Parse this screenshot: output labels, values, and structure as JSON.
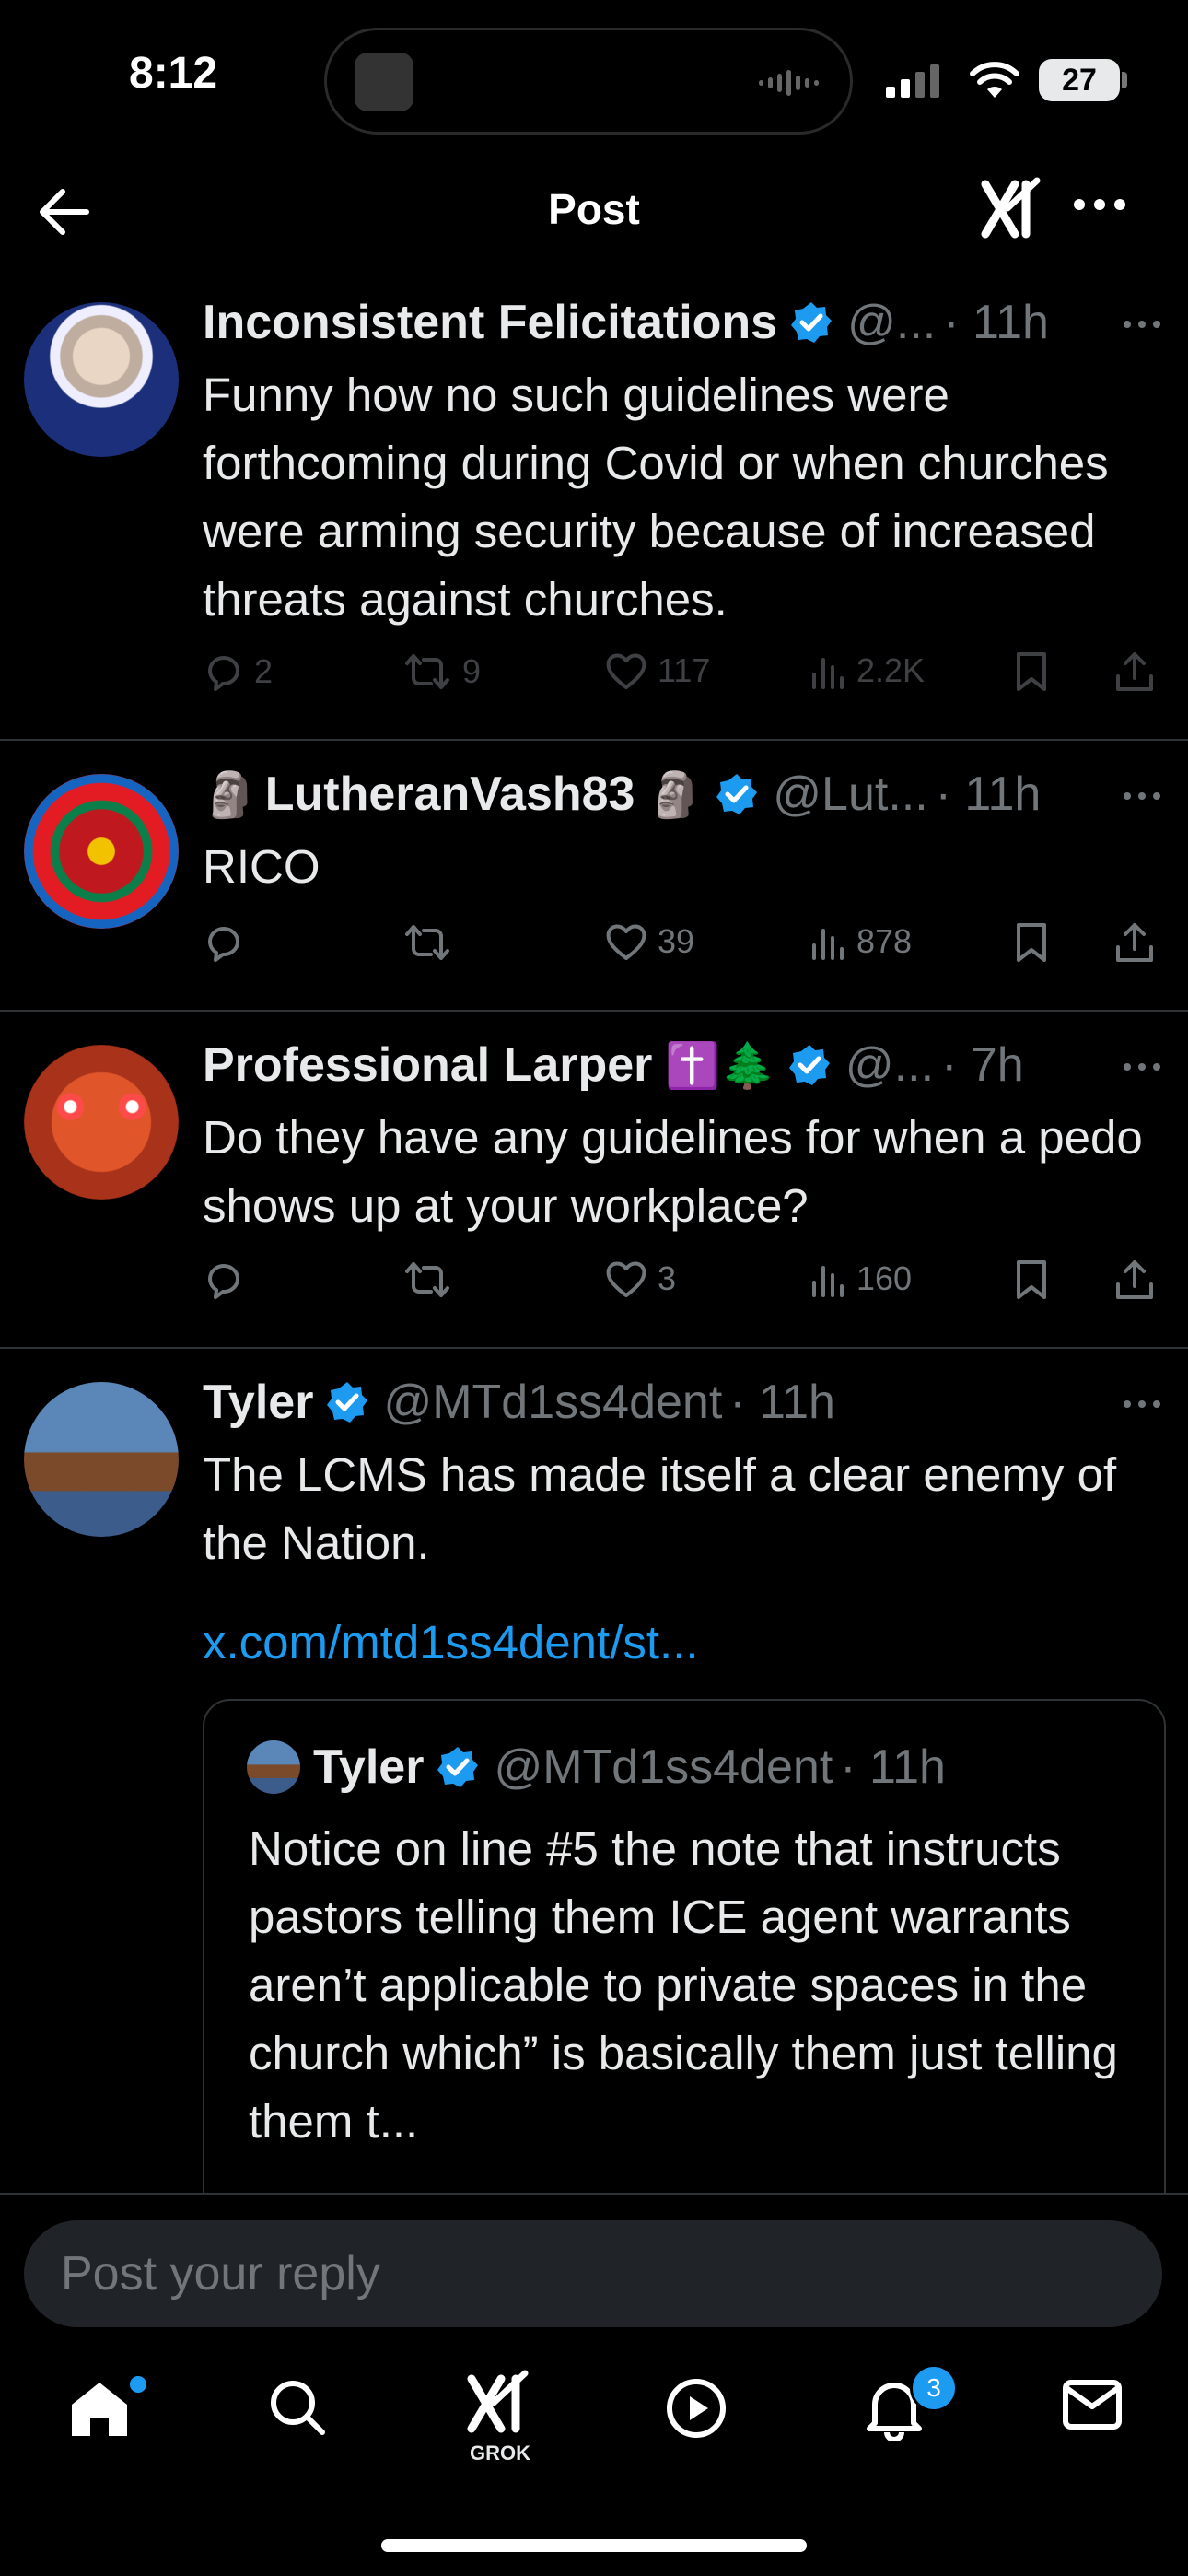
{
  "status_bar": {
    "time": "8:12",
    "battery": "27"
  },
  "header": {
    "title": "Post"
  },
  "posts": [
    {
      "name": "Inconsistent Felicitations",
      "handle": "@...",
      "time": "· 11h",
      "text": "Funny how no such guidelines were forthcoming during Covid or when churches were arming security because of increased threats against churches.",
      "replies": "2",
      "reposts": "9",
      "likes": "117",
      "views": "2.2K"
    },
    {
      "name_prefix_emoji": "🗿",
      "name": "LutheranVash83",
      "name_suffix_emoji": "🗿",
      "handle": "@Lut...",
      "time": "· 11h",
      "text": "RICO",
      "likes": "39",
      "views": "878"
    },
    {
      "name": "Professional Larper",
      "name_emojis": "✝️🌲",
      "handle": "@...",
      "time": "· 7h",
      "text": "Do they have any guidelines for when a pedo shows up at your workplace?",
      "likes": "3",
      "views": "160"
    },
    {
      "name": "Tyler",
      "handle": "@MTd1ss4dent",
      "time": "· 11h",
      "text": "The LCMS has made itself a clear enemy of the Nation.",
      "link": "x.com/mtd1ss4dent/st...",
      "quote": {
        "name": "Tyler",
        "handle": "@MTd1ss4dent",
        "time": "· 11h",
        "text": "Notice on line #5 the note that instructs pastors telling them ICE agent warrants aren’t applicable to private spaces in the church which” is basically them just telling them t..."
      }
    }
  ],
  "reply": {
    "placeholder": "Post your reply"
  },
  "nav": {
    "grok_label": "GROK",
    "notifications_count": "3"
  },
  "colors": {
    "accent": "#1d9bf0",
    "background": "#000000",
    "muted": "#71767b",
    "divider": "#2f3336"
  }
}
